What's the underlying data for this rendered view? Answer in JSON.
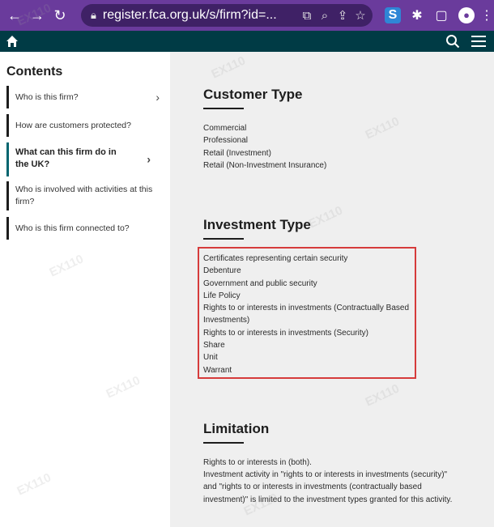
{
  "browser": {
    "url": "register.fca.org.uk/s/firm?id=...",
    "icons": [
      "back-icon",
      "forward-icon",
      "reload-icon",
      "lock-icon",
      "translate-icon",
      "zoom-icon",
      "share-icon",
      "star-icon",
      "extension-s-icon",
      "puzzle-icon",
      "sidebar-icon",
      "profile-icon",
      "more-icon"
    ],
    "ext_s_label": "S",
    "accent": "#6a3b9c"
  },
  "site": {
    "bar_color": "#003b45"
  },
  "sidebar": {
    "title": "Contents",
    "items": [
      {
        "label": "Who is this firm?"
      },
      {
        "label": "How are customers protected?"
      },
      {
        "label": "What can this firm do in the UK?"
      },
      {
        "label": "Who is involved with activities at this firm?"
      },
      {
        "label": "Who is this firm connected to?"
      }
    ]
  },
  "customer_type": {
    "title": "Customer Type",
    "items": [
      "Commercial",
      "Professional",
      "Retail (Investment)",
      "Retail (Non-Investment Insurance)"
    ]
  },
  "investment_type": {
    "title": "Investment Type",
    "items": [
      "Certificates representing certain security",
      "Debenture",
      "Government and public security",
      "Life Policy",
      "Rights to or interests in investments (Contractually Based Investments)",
      "Rights to or interests in investments (Security)",
      "Share",
      "Unit",
      "Warrant"
    ],
    "highlight_color": "#d63b3b"
  },
  "limitation": {
    "title": "Limitation",
    "line1": "Rights to or interests in (both).",
    "line2": "Investment activity in \"rights to or interests in investments (security)\" and \"rights to or interests in investments (contractually based investment)\" is limited to the investment types granted for this activity."
  }
}
